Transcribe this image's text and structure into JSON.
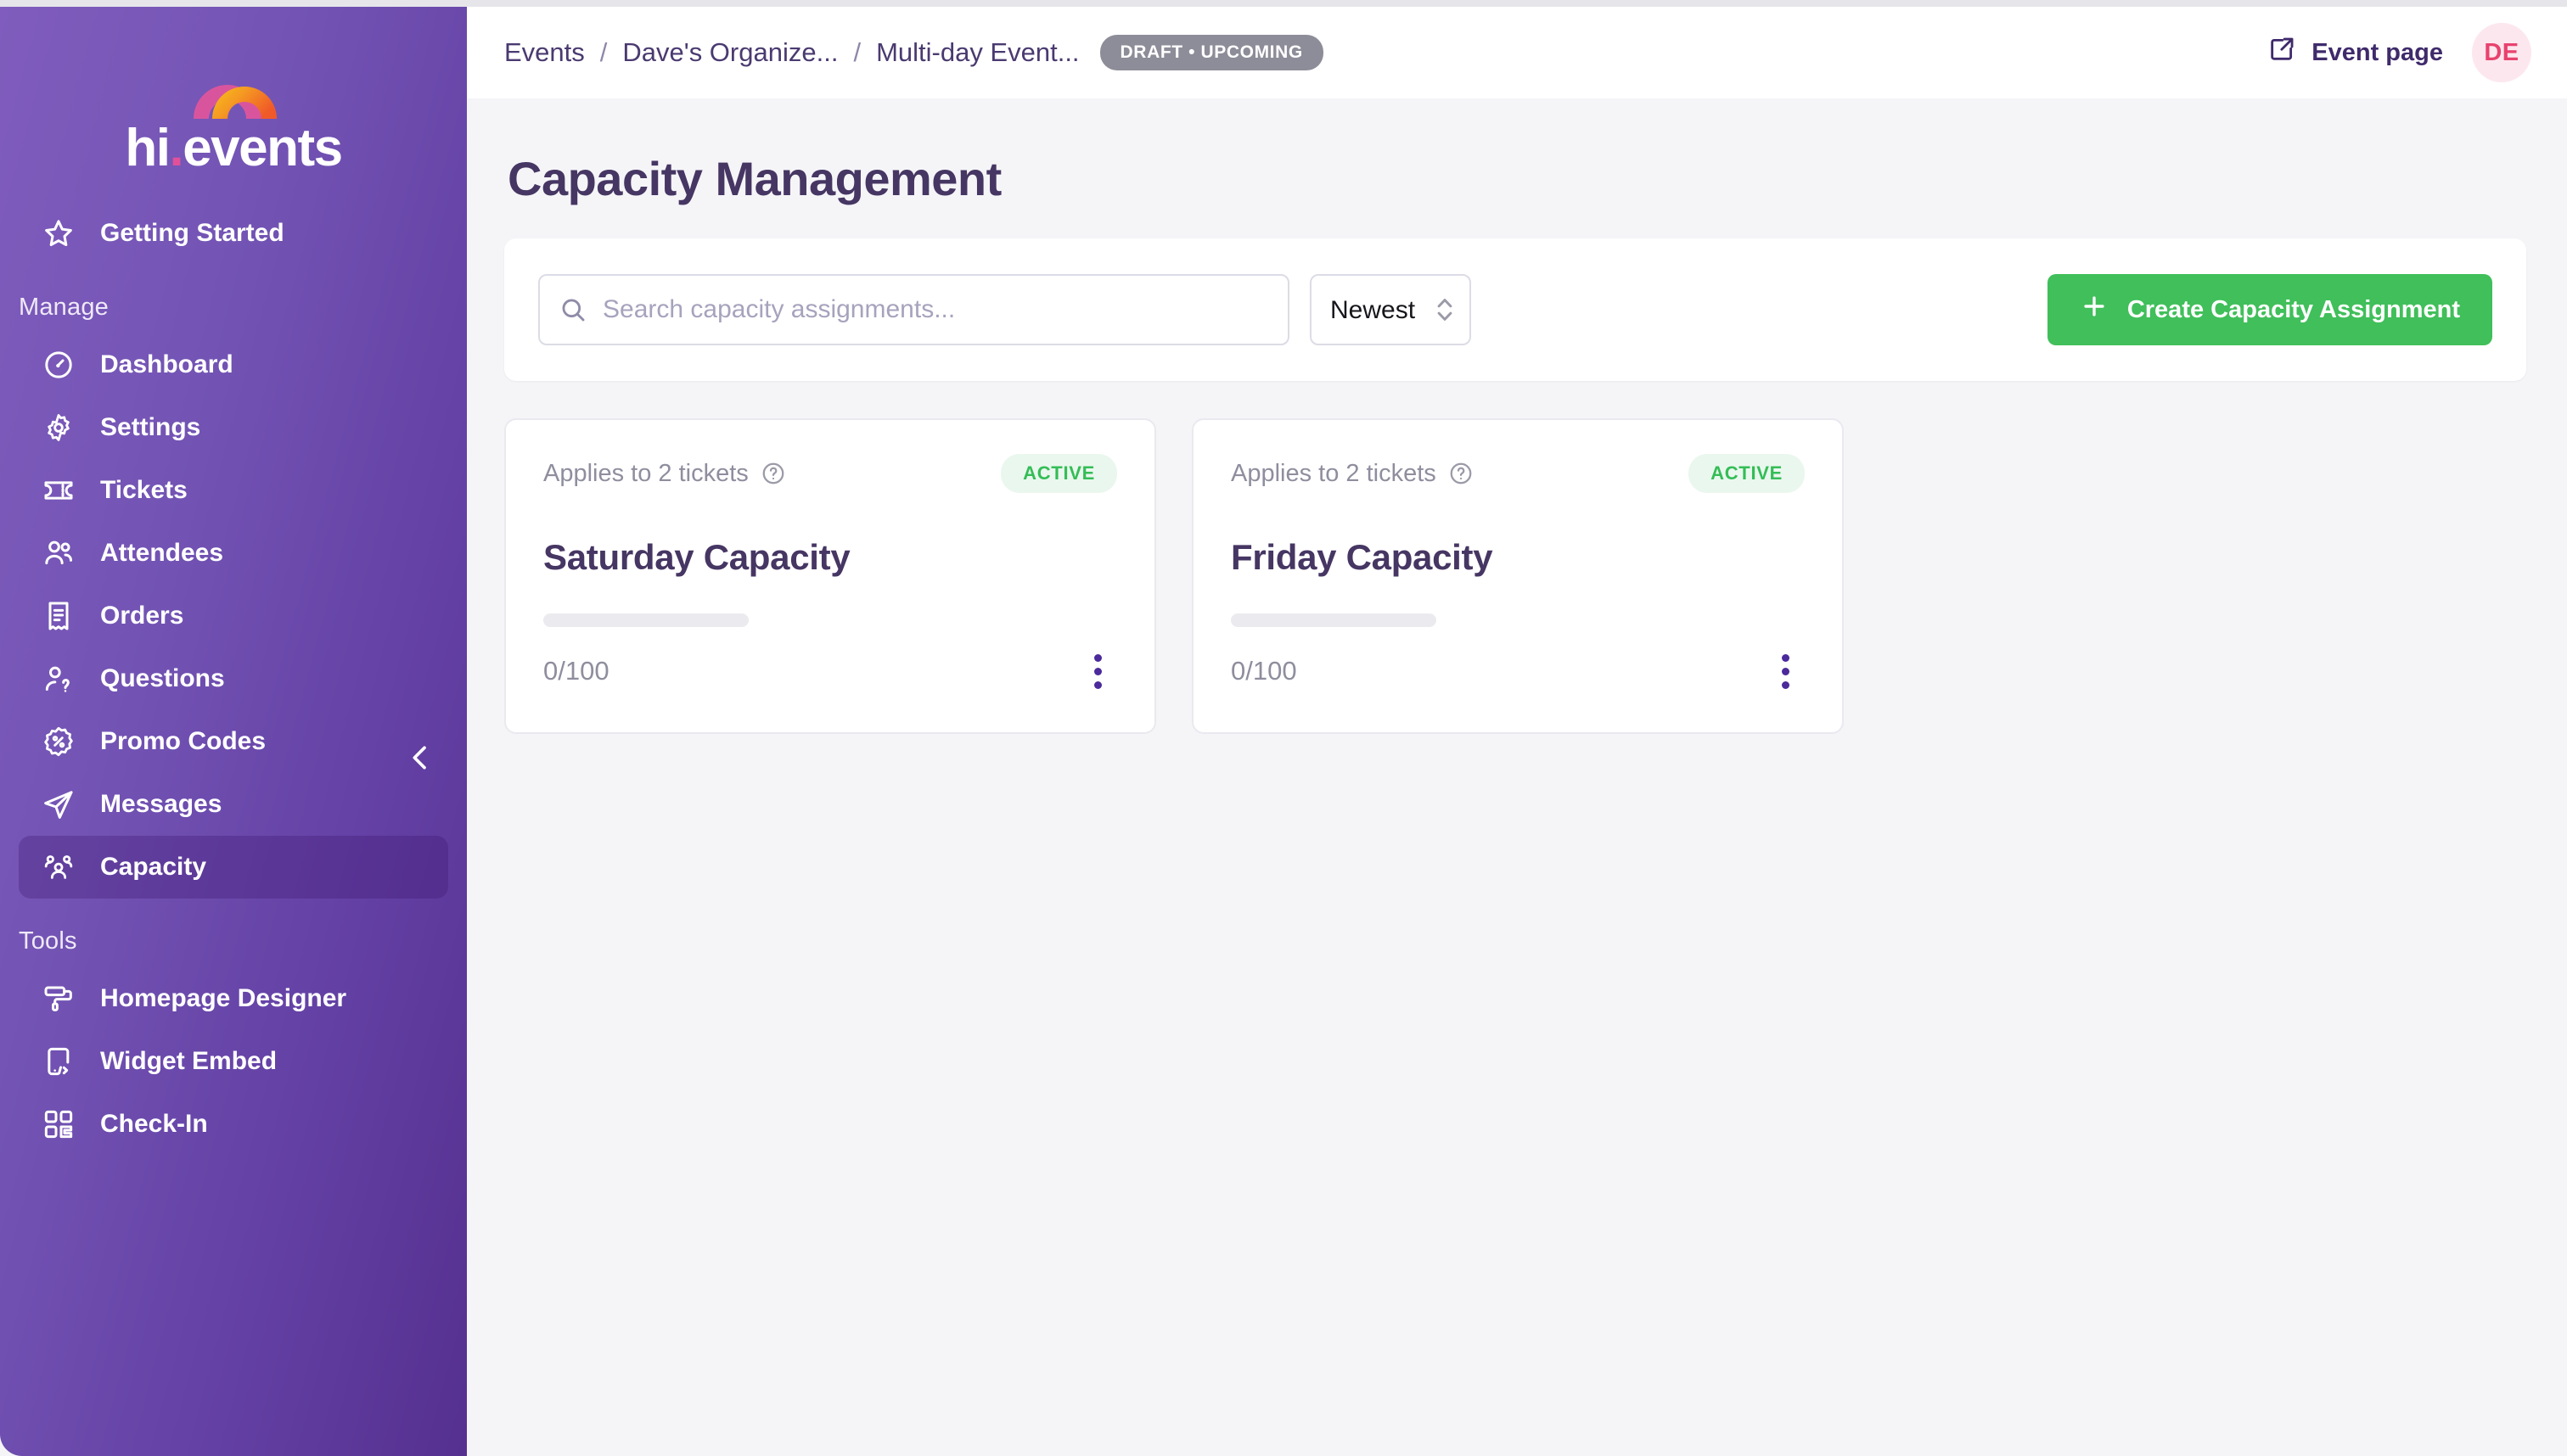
{
  "brand": {
    "name": "hi.events",
    "name_prefix": "hi",
    "name_dot": ".",
    "name_suffix": "events",
    "logo_colors": {
      "arc_back": "#d8559e",
      "arc_front_start": "#f5b400",
      "arc_front_end": "#f05a28",
      "dot": "#e0519a"
    }
  },
  "sidebar": {
    "top_items": [
      {
        "label": "Getting Started",
        "icon": "star-icon"
      }
    ],
    "sections": [
      {
        "title": "Manage",
        "items": [
          {
            "label": "Dashboard",
            "icon": "gauge-icon",
            "active": false
          },
          {
            "label": "Settings",
            "icon": "gear-icon",
            "active": false
          },
          {
            "label": "Tickets",
            "icon": "ticket-icon",
            "active": false
          },
          {
            "label": "Attendees",
            "icon": "users-icon",
            "active": false
          },
          {
            "label": "Orders",
            "icon": "receipt-icon",
            "active": false
          },
          {
            "label": "Questions",
            "icon": "user-question-icon",
            "active": false
          },
          {
            "label": "Promo Codes",
            "icon": "percent-badge-icon",
            "active": false
          },
          {
            "label": "Messages",
            "icon": "paper-plane-icon",
            "active": false
          },
          {
            "label": "Capacity",
            "icon": "capacity-group-icon",
            "active": true
          }
        ]
      },
      {
        "title": "Tools",
        "items": [
          {
            "label": "Homepage Designer",
            "icon": "paint-roller-icon",
            "active": false
          },
          {
            "label": "Widget Embed",
            "icon": "device-code-icon",
            "active": false
          },
          {
            "label": "Check-In",
            "icon": "qr-code-icon",
            "active": false
          }
        ]
      }
    ],
    "collapse_icon": "chevron-left-icon"
  },
  "header": {
    "breadcrumb": [
      {
        "label": "Events"
      },
      {
        "label": "Dave's Organize..."
      },
      {
        "label": "Multi-day Event..."
      }
    ],
    "separator": "/",
    "status_badge": "DRAFT • UPCOMING",
    "event_page_label": "Event page",
    "event_page_icon": "external-link-icon",
    "avatar_initials": "DE"
  },
  "main": {
    "page_title": "Capacity Management",
    "toolbar": {
      "search_placeholder": "Search capacity assignments...",
      "search_value": "",
      "search_icon": "search-icon",
      "sort_selected": "Newest first",
      "sort_options": [
        "Newest first"
      ],
      "sort_icon": "chevron-updown-icon",
      "create_label": "Create Capacity Assignment",
      "create_icon": "plus-icon",
      "create_color": "#40bf5a"
    },
    "cards": [
      {
        "applies_to": "Applies to 2 tickets",
        "help_icon": "help-circle-icon",
        "status": "ACTIVE",
        "status_color": "#34bd56",
        "title": "Saturday Capacity",
        "used": 0,
        "total": 100,
        "count_label": "0/100",
        "progress_percent": 0,
        "menu_icon": "kebab-menu-icon"
      },
      {
        "applies_to": "Applies to 2 tickets",
        "help_icon": "help-circle-icon",
        "status": "ACTIVE",
        "status_color": "#34bd56",
        "title": "Friday Capacity",
        "used": 0,
        "total": 100,
        "count_label": "0/100",
        "progress_percent": 0,
        "menu_icon": "kebab-menu-icon"
      }
    ]
  }
}
